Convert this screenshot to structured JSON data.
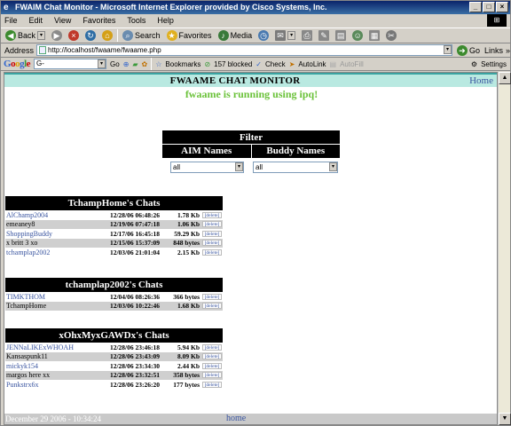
{
  "window": {
    "title": "FWAIM Chat Monitor - Microsoft Internet Explorer provided by Cisco Systems, Inc.",
    "minimize": "_",
    "maximize": "□",
    "close": "×"
  },
  "menubar": [
    "File",
    "Edit",
    "View",
    "Favorites",
    "Tools",
    "Help"
  ],
  "toolbar": {
    "back": "Back",
    "search": "Search",
    "favorites": "Favorites",
    "media": "Media"
  },
  "addressbar": {
    "label": "Address",
    "url": "http://localhost/fwaame/fwaame.php",
    "go": "Go",
    "links": "Links"
  },
  "googlebar": {
    "logo": "Google",
    "search_value": "G-",
    "go": "Go",
    "bookmarks": "Bookmarks",
    "blocked": "157 blocked",
    "check": "Check",
    "autolink": "AutoLink",
    "autofill": "AutoFill",
    "settings": "Settings"
  },
  "page": {
    "header_title": "FWAAME CHAT MONITOR",
    "header_link": "Home",
    "running": "fwaame is running using ipq!",
    "filter": {
      "title": "Filter",
      "col_aim": "AIM Names",
      "col_buddy": "Buddy Names",
      "aim_value": "all",
      "buddy_value": "all"
    },
    "chat_blocks": [
      {
        "title": "TchampHome's Chats",
        "rows": [
          {
            "name": "AlChamp2004",
            "date": "12/28/06 06:48:26",
            "size": "1.78 Kb",
            "del": "[delete]",
            "link": true
          },
          {
            "name": "emeaney8",
            "date": "12/19/06 07:47:18",
            "size": "1.06 Kb",
            "del": "[delete]",
            "link": false
          },
          {
            "name": "ShoppingBuddy",
            "date": "12/17/06 16:45:18",
            "size": "59.29 Kb",
            "del": "[delete]",
            "link": true
          },
          {
            "name": "x britt 3 xo",
            "date": "12/15/06 15:37:09",
            "size": "848 bytes",
            "del": "[delete]",
            "link": false
          },
          {
            "name": "tchamplap2002",
            "date": "12/03/06 21:01:04",
            "size": "2.15 Kb",
            "del": "[delete]",
            "link": true
          }
        ]
      },
      {
        "title": "tchamplap2002's Chats",
        "rows": [
          {
            "name": "TIMKTHOM",
            "date": "12/04/06 08:26:36",
            "size": "366 bytes",
            "del": "[delete]",
            "link": true
          },
          {
            "name": "TchampHome",
            "date": "12/03/06 10:22:46",
            "size": "1.68 Kb",
            "del": "[delete]",
            "link": false
          }
        ]
      },
      {
        "title": "xOhxMyxGAWDx's Chats",
        "rows": [
          {
            "name": "JENNaLIKExWHOAH",
            "date": "12/28/06 23:46:18",
            "size": "5.94 Kb",
            "del": "[delete]",
            "link": true
          },
          {
            "name": "Kansaspunk11",
            "date": "12/28/06 23:43:09",
            "size": "8.09 Kb",
            "del": "[delete]",
            "link": false
          },
          {
            "name": "mickyk154",
            "date": "12/28/06 23:34:30",
            "size": "2.44 Kb",
            "del": "[delete]",
            "link": true
          },
          {
            "name": "margos here xx",
            "date": "12/28/06 23:32:51",
            "size": "358 bytes",
            "del": "[delete]",
            "link": false
          },
          {
            "name": "Punkstrx6x",
            "date": "12/28/06 23:26:20",
            "size": "177 bytes",
            "del": "[delete]",
            "link": true
          }
        ]
      }
    ],
    "footer_date": "December 29 2006 - 10:34:24",
    "footer_home": "home"
  }
}
